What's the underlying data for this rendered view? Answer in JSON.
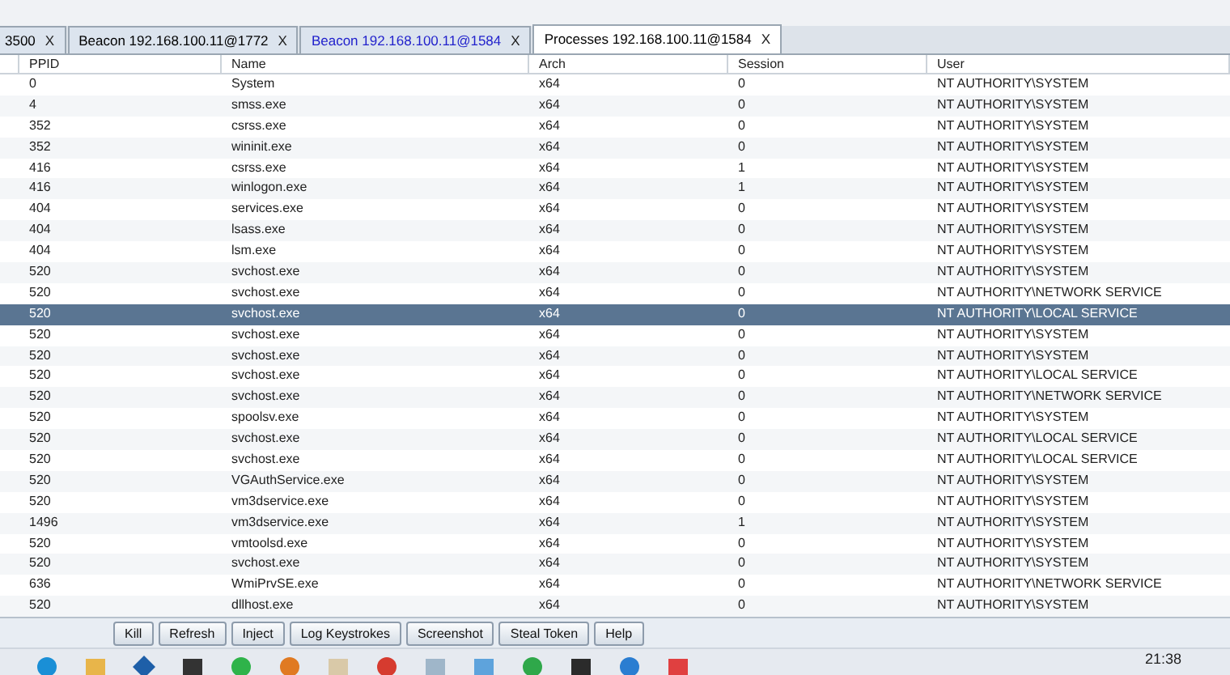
{
  "tabs": [
    {
      "label": "3500",
      "close": "X",
      "selected": false,
      "color": "#000000"
    },
    {
      "label": "Beacon 192.168.100.11@1772",
      "close": "X",
      "selected": false,
      "color": "#000000"
    },
    {
      "label": "Beacon 192.168.100.11@1584",
      "close": "X",
      "selected": false,
      "color": "#2222cc"
    },
    {
      "label": "Processes 192.168.100.11@1584",
      "close": "X",
      "selected": true,
      "color": "#000000"
    }
  ],
  "table": {
    "columns": [
      "PPID",
      "Name",
      "Arch",
      "Session",
      "User"
    ],
    "rows": [
      {
        "cells": [
          "0",
          "System",
          "x64",
          "0",
          "NT AUTHORITY\\SYSTEM"
        ],
        "selected": false
      },
      {
        "cells": [
          "4",
          "smss.exe",
          "x64",
          "0",
          "NT AUTHORITY\\SYSTEM"
        ],
        "selected": false
      },
      {
        "cells": [
          "352",
          "csrss.exe",
          "x64",
          "0",
          "NT AUTHORITY\\SYSTEM"
        ],
        "selected": false
      },
      {
        "cells": [
          "352",
          "wininit.exe",
          "x64",
          "0",
          "NT AUTHORITY\\SYSTEM"
        ],
        "selected": false
      },
      {
        "cells": [
          "416",
          "csrss.exe",
          "x64",
          "1",
          "NT AUTHORITY\\SYSTEM"
        ],
        "selected": false
      },
      {
        "cells": [
          "416",
          "winlogon.exe",
          "x64",
          "1",
          "NT AUTHORITY\\SYSTEM"
        ],
        "selected": false
      },
      {
        "cells": [
          "404",
          "services.exe",
          "x64",
          "0",
          "NT AUTHORITY\\SYSTEM"
        ],
        "selected": false
      },
      {
        "cells": [
          "404",
          "lsass.exe",
          "x64",
          "0",
          "NT AUTHORITY\\SYSTEM"
        ],
        "selected": false
      },
      {
        "cells": [
          "404",
          "lsm.exe",
          "x64",
          "0",
          "NT AUTHORITY\\SYSTEM"
        ],
        "selected": false
      },
      {
        "cells": [
          "520",
          "svchost.exe",
          "x64",
          "0",
          "NT AUTHORITY\\SYSTEM"
        ],
        "selected": false
      },
      {
        "cells": [
          "520",
          "svchost.exe",
          "x64",
          "0",
          "NT AUTHORITY\\NETWORK SERVICE"
        ],
        "selected": false
      },
      {
        "cells": [
          "520",
          "svchost.exe",
          "x64",
          "0",
          "NT AUTHORITY\\LOCAL SERVICE"
        ],
        "selected": true
      },
      {
        "cells": [
          "520",
          "svchost.exe",
          "x64",
          "0",
          "NT AUTHORITY\\SYSTEM"
        ],
        "selected": false
      },
      {
        "cells": [
          "520",
          "svchost.exe",
          "x64",
          "0",
          "NT AUTHORITY\\SYSTEM"
        ],
        "selected": false
      },
      {
        "cells": [
          "520",
          "svchost.exe",
          "x64",
          "0",
          "NT AUTHORITY\\LOCAL SERVICE"
        ],
        "selected": false
      },
      {
        "cells": [
          "520",
          "svchost.exe",
          "x64",
          "0",
          "NT AUTHORITY\\NETWORK SERVICE"
        ],
        "selected": false
      },
      {
        "cells": [
          "520",
          "spoolsv.exe",
          "x64",
          "0",
          "NT AUTHORITY\\SYSTEM"
        ],
        "selected": false
      },
      {
        "cells": [
          "520",
          "svchost.exe",
          "x64",
          "0",
          "NT AUTHORITY\\LOCAL SERVICE"
        ],
        "selected": false
      },
      {
        "cells": [
          "520",
          "svchost.exe",
          "x64",
          "0",
          "NT AUTHORITY\\LOCAL SERVICE"
        ],
        "selected": false
      },
      {
        "cells": [
          "520",
          "VGAuthService.exe",
          "x64",
          "0",
          "NT AUTHORITY\\SYSTEM"
        ],
        "selected": false
      },
      {
        "cells": [
          "520",
          "vm3dservice.exe",
          "x64",
          "0",
          "NT AUTHORITY\\SYSTEM"
        ],
        "selected": false
      },
      {
        "cells": [
          "1496",
          "vm3dservice.exe",
          "x64",
          "1",
          "NT AUTHORITY\\SYSTEM"
        ],
        "selected": false
      },
      {
        "cells": [
          "520",
          "vmtoolsd.exe",
          "x64",
          "0",
          "NT AUTHORITY\\SYSTEM"
        ],
        "selected": false
      },
      {
        "cells": [
          "520",
          "svchost.exe",
          "x64",
          "0",
          "NT AUTHORITY\\SYSTEM"
        ],
        "selected": false
      },
      {
        "cells": [
          "636",
          "WmiPrvSE.exe",
          "x64",
          "0",
          "NT AUTHORITY\\NETWORK SERVICE"
        ],
        "selected": false
      },
      {
        "cells": [
          "520",
          "dllhost.exe",
          "x64",
          "0",
          "NT AUTHORITY\\SYSTEM"
        ],
        "selected": false
      }
    ]
  },
  "buttons": [
    "Kill",
    "Refresh",
    "Inject",
    "Log Keystrokes",
    "Screenshot",
    "Steal Token",
    "Help"
  ],
  "taskbar": {
    "time": "21:38"
  }
}
